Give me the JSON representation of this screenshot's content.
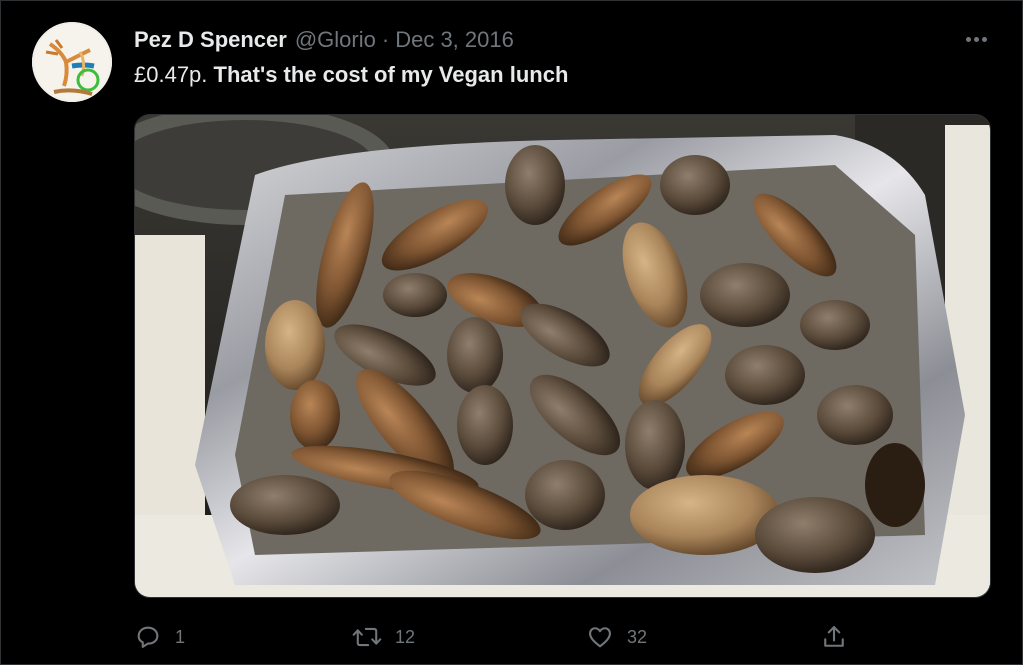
{
  "tweet": {
    "author_name": "Pez D Spencer",
    "handle": "@Glorio",
    "separator": "·",
    "date": "Dec 3, 2016",
    "text_prefix": "£0.47p.",
    "text_main": "That's the cost of my Vegan lunch",
    "media_icon": "photo-pine-cones-in-foil-tray",
    "stats": {
      "replies": "1",
      "retweets": "12",
      "likes": "32"
    }
  },
  "icons": {
    "more": "more-horizontal-icon",
    "reply": "speech-bubble-icon",
    "retweet": "retweet-arrows-icon",
    "like": "heart-icon",
    "share": "share-upload-icon"
  },
  "colors": {
    "background": "#000000",
    "text_primary": "#e7e9ea",
    "text_secondary": "#71767b",
    "border": "#2f3336"
  }
}
